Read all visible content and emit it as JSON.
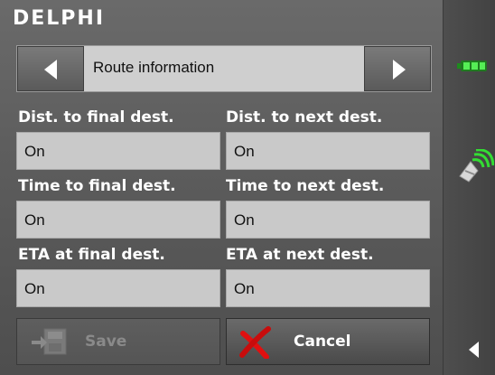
{
  "brand": {
    "logo_text": "DELPHI"
  },
  "selector": {
    "title": "Route information",
    "prev_icon": "arrow-left-icon",
    "next_icon": "arrow-right-icon"
  },
  "options": [
    {
      "label": "Dist. to final dest.",
      "value": "On"
    },
    {
      "label": "Dist. to next dest.",
      "value": "On"
    },
    {
      "label": "Time to final dest.",
      "value": "On"
    },
    {
      "label": "Time to next dest.",
      "value": "On"
    },
    {
      "label": "ETA at final dest.",
      "value": "On"
    },
    {
      "label": "ETA at next dest.",
      "value": "On"
    }
  ],
  "buttons": {
    "save": {
      "label": "Save",
      "icon": "save-icon",
      "enabled": false
    },
    "cancel": {
      "label": "Cancel",
      "icon": "red-x-icon"
    }
  },
  "status": {
    "battery_icon": "battery-icon",
    "battery_color": "#33cc33",
    "gps_icon": "satellite-signal-icon",
    "back_icon": "arrow-left-icon"
  },
  "colors": {
    "cancel_x": "#e01010",
    "signal": "#33dd33"
  }
}
